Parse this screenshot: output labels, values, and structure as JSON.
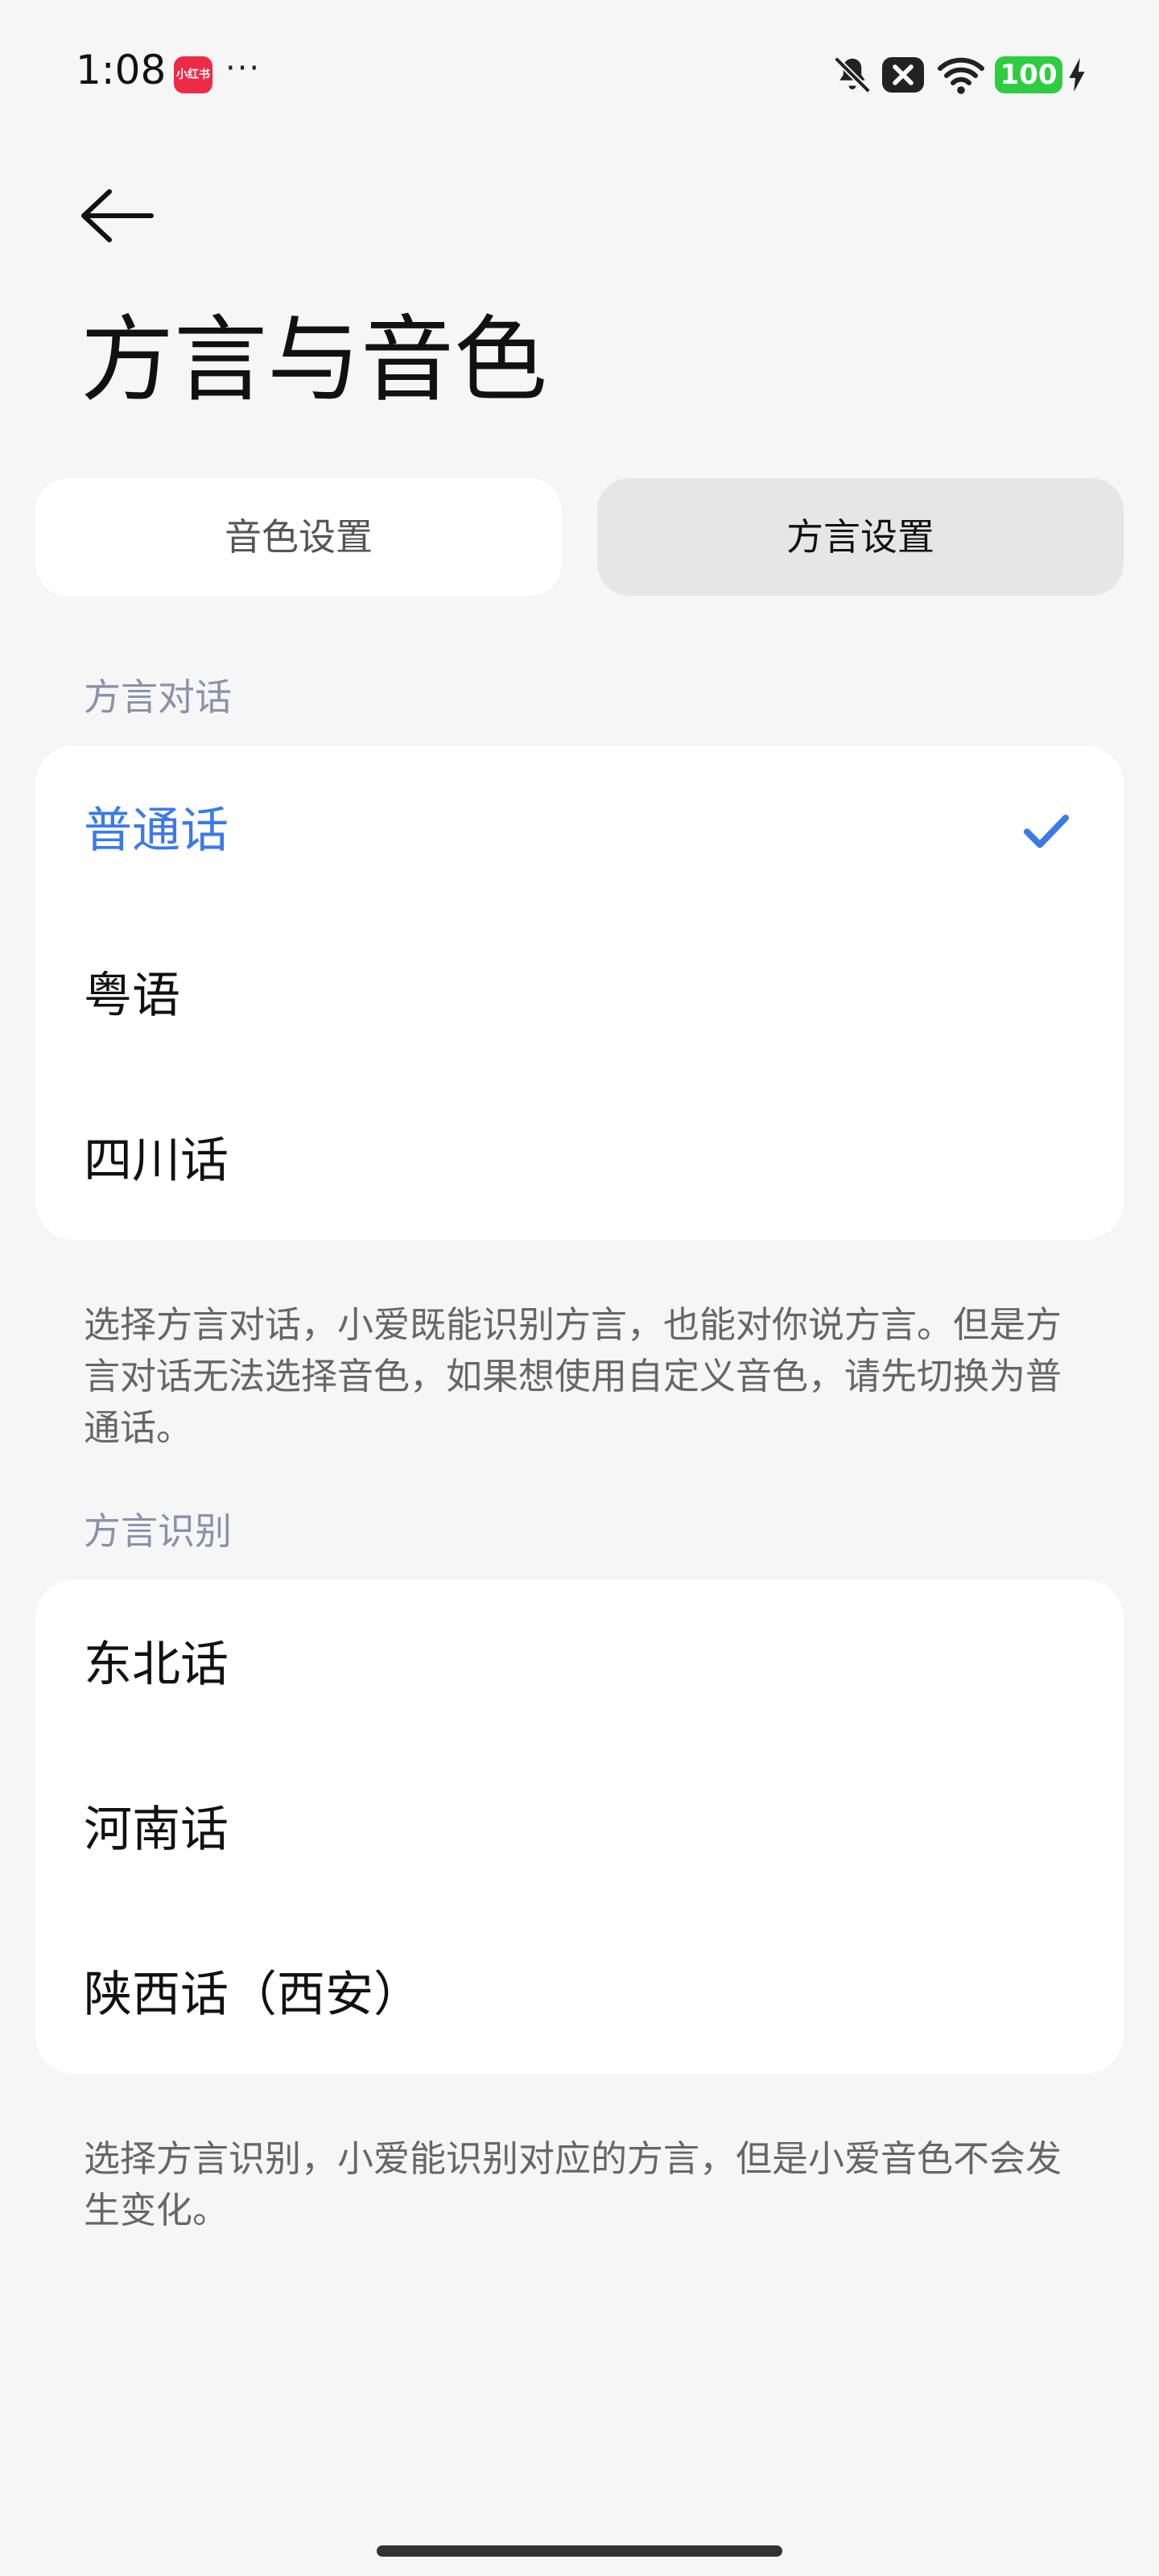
{
  "status_bar": {
    "time": "1:08",
    "app_badge": "小红书",
    "more": "···",
    "battery": "100"
  },
  "header": {
    "title": "方言与音色"
  },
  "tabs": [
    {
      "label": "音色设置"
    },
    {
      "label": "方言设置"
    }
  ],
  "dialect_dialog": {
    "section_label": "方言对话",
    "items": [
      {
        "label": "普通话",
        "selected": true
      },
      {
        "label": "粤语"
      },
      {
        "label": "四川话"
      }
    ],
    "note": "选择方言对话，小爱既能识别方言，也能对你说方言。但是方言对话无法选择音色，如果想使用自定义音色，请先切换为普通话。"
  },
  "dialect_recognition": {
    "section_label": "方言识别",
    "items": [
      {
        "label": "东北话"
      },
      {
        "label": "河南话"
      },
      {
        "label": "陕西话（西安）"
      }
    ],
    "note": "选择方言识别，小爱能识别对应的方言，但是小爱音色不会发生变化。"
  },
  "colors": {
    "accent": "#3b7ae8",
    "background": "#f6f6f6",
    "section_label": "#8a91a8",
    "battery": "#2ecc40",
    "app_badge": "#ee2b46"
  },
  "icons": [
    "back-arrow-icon",
    "check-icon",
    "mute-bell-icon",
    "close-box-icon",
    "wifi-icon",
    "charging-icon"
  ]
}
